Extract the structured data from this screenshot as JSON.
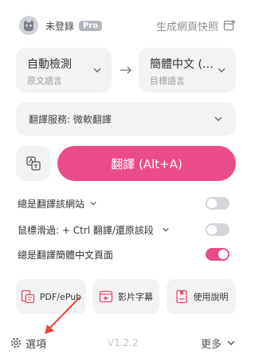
{
  "header": {
    "username": "未登錄",
    "badge": "Pro",
    "snapshot_label": "生成網頁快照"
  },
  "languages": {
    "source_main": "自動檢測",
    "source_sub": "原文語言",
    "target_main": "簡體中文 (S...",
    "target_sub": "目標語言"
  },
  "service": {
    "label": "翻譯服務: 微軟翻譯"
  },
  "translate_button": {
    "label": "翻譯 (Alt+A)"
  },
  "settings": [
    {
      "label": "總是翻譯該網站",
      "has_dropdown": true,
      "enabled": false
    },
    {
      "label": "鼠標滑過: + Ctrl 翻譯/還原該段",
      "has_dropdown": true,
      "enabled": false
    },
    {
      "label": "總是翻譯簡體中文頁面",
      "has_dropdown": false,
      "enabled": true
    }
  ],
  "tools": {
    "pdf": "PDF/ePub",
    "subtitles": "影片字幕",
    "manual": "使用說明"
  },
  "footer": {
    "options": "選項",
    "version": "V1.2.2",
    "more": "更多"
  },
  "colors": {
    "accent": "#ea4c89",
    "panel": "#f2f3f5",
    "annotation_arrow": "#e8443a"
  }
}
